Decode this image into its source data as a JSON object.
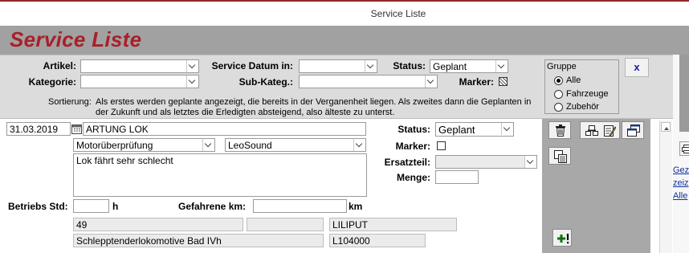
{
  "window": {
    "title": "Service Liste"
  },
  "app": {
    "title": "Service Liste"
  },
  "filters": {
    "artikel_label": "Artikel:",
    "kategorie_label": "Kategorie:",
    "service_datum_label": "Service Datum in:",
    "sub_kateg_label": "Sub-Kateg.:",
    "status_label": "Status:",
    "status_value": "Geplant",
    "marker_label": "Marker:"
  },
  "sort_note": {
    "label": "Sortierung:",
    "line1": "Als erstes werden geplante angezeigt, die bereits in der Verganenheit liegen. Als zweites dann die Geplanten in",
    "line2": "der Zukunft und als letztes die Erledigten absteigend, also älteste zu unterst."
  },
  "group": {
    "title": "Gruppe",
    "options": [
      "Alle",
      "Fahrzeuge",
      "Zubehör"
    ],
    "selected": "Alle"
  },
  "close_button": {
    "label": "x"
  },
  "record": {
    "date": "31.03.2019",
    "title": "ARTUNG LOK",
    "type": "Motorüberprüfung",
    "supplier": "LeoSound",
    "description": "Lok fährt sehr schlecht",
    "status_label": "Status:",
    "status_value": "Geplant",
    "marker_label": "Marker:",
    "ersatzteil_label": "Ersatzteil:",
    "ersatzteil_value": "",
    "menge_label": "Menge:",
    "menge_value": "",
    "betriebs_label": "Betriebs Std:",
    "betriebs_value": "",
    "betriebs_unit": "h",
    "km_label": "Gefahrene km:",
    "km_value": "",
    "km_unit": "km",
    "number": "49",
    "blank_field": "",
    "brand": "LILIPUT",
    "model_name": "Schlepptenderlokomotive Bad IVh",
    "model_number": "L104000"
  },
  "right_panel": {
    "links": [
      "Gez",
      "zeiz",
      "Alle"
    ]
  },
  "icons": {
    "delete": "trash-icon",
    "copy": "copy-icon",
    "edit": "edit-icon",
    "view": "window-icon",
    "duplicate": "duplicate-icon",
    "add": "add-record-icon",
    "print": "print-icon"
  },
  "colors": {
    "title_red": "#a8202a",
    "accent_green": "#107010",
    "link_blue": "#1030a0"
  }
}
